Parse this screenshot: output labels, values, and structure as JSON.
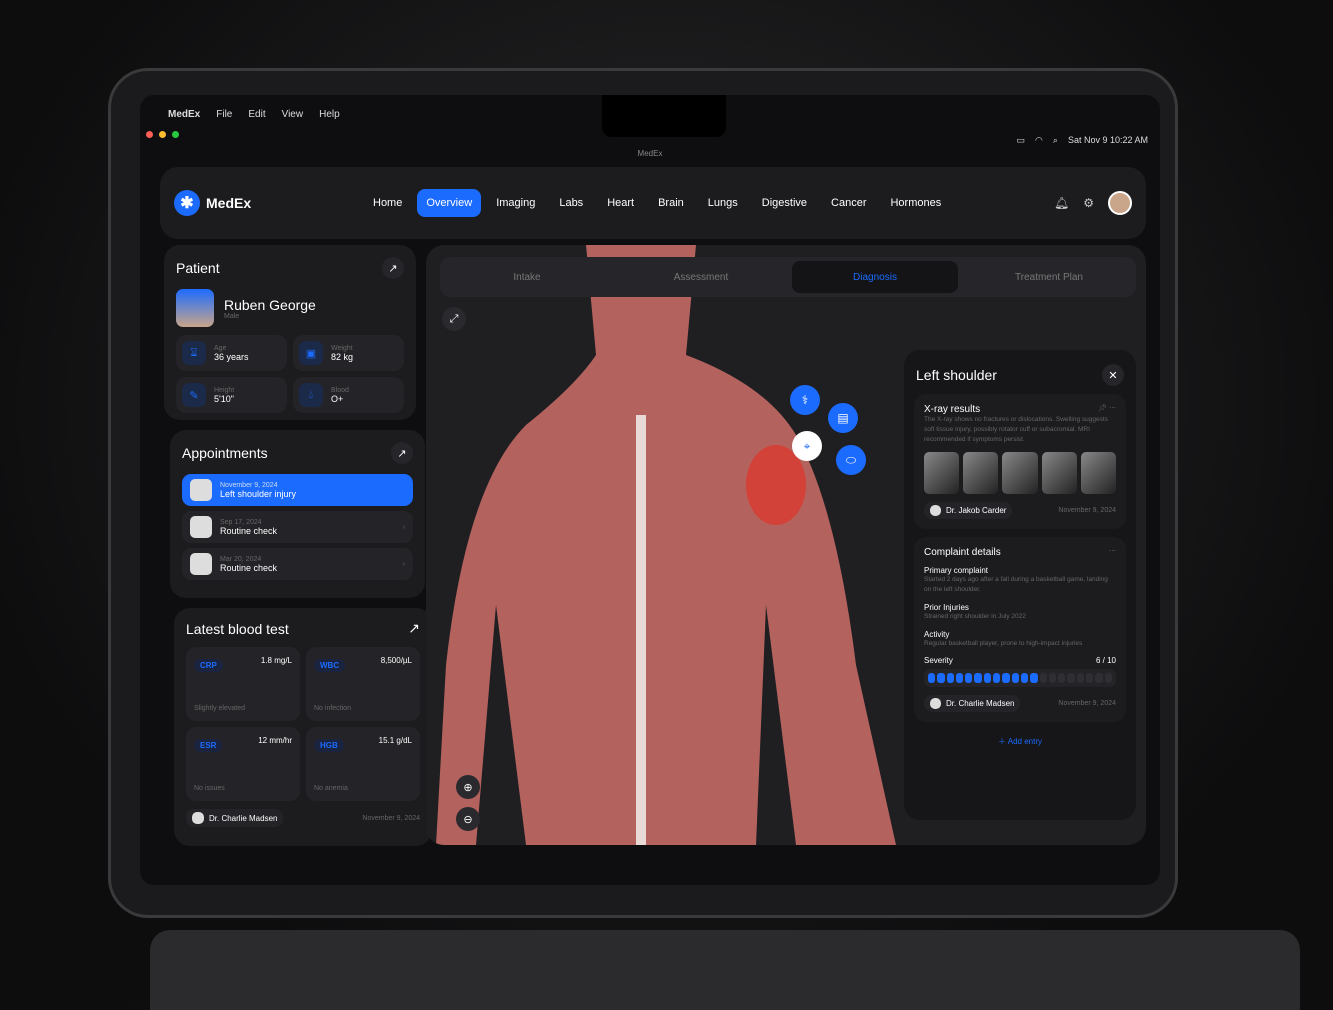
{
  "menubar": {
    "app": "MedEx",
    "items": [
      "File",
      "Edit",
      "View",
      "Help"
    ],
    "datetime": "Sat Nov 9  10:22 AM"
  },
  "window": {
    "title": "MedEx"
  },
  "nav": {
    "brand": "MedEx",
    "tabs": [
      "Home",
      "Overview",
      "Imaging",
      "Labs",
      "Heart",
      "Brain",
      "Lungs",
      "Digestive",
      "Cancer",
      "Hormones"
    ],
    "active": "Overview"
  },
  "patient": {
    "title": "Patient",
    "name": "Ruben George",
    "sex": "Male",
    "stats": [
      {
        "label": "Age",
        "value": "36 years",
        "icon": "hourglass-icon"
      },
      {
        "label": "Weight",
        "value": "82 kg",
        "icon": "scale-icon"
      },
      {
        "label": "Height",
        "value": "5'10\"",
        "icon": "ruler-icon"
      },
      {
        "label": "Blood",
        "value": "O+",
        "icon": "drop-icon"
      }
    ]
  },
  "appointments": {
    "title": "Appointments",
    "items": [
      {
        "date": "November 9, 2024",
        "title": "Left shoulder injury"
      },
      {
        "date": "Sep 17, 2024",
        "title": "Routine check"
      },
      {
        "date": "Mar 20, 2024",
        "title": "Routine check"
      }
    ]
  },
  "blood": {
    "title": "Latest blood test",
    "tests": [
      {
        "tag": "CRP",
        "value": "1.8 mg/L",
        "note": "Slightly elevated"
      },
      {
        "tag": "WBC",
        "value": "8,500/µL",
        "note": "No infection"
      },
      {
        "tag": "ESR",
        "value": "12 mm/hr",
        "note": "No issues"
      },
      {
        "tag": "HGB",
        "value": "15.1 g/dL",
        "note": "No anemia"
      }
    ],
    "doctor": "Dr. Charlie Madsen",
    "date": "November 9, 2024"
  },
  "steps": {
    "items": [
      "Intake",
      "Assessment",
      "Diagnosis",
      "Treatment Plan"
    ],
    "active": "Diagnosis"
  },
  "detail": {
    "title": "Left shoulder",
    "xray": {
      "title": "X-ray results",
      "text": "The X-ray shows no fractures or dislocations. Swelling suggests soft tissue injury, possibly rotator cuff or subacromial. MRI recommended if symptoms persist.",
      "doctor": "Dr. Jakob Carder",
      "date": "November 9, 2024"
    },
    "complaint": {
      "title": "Complaint details",
      "primary_label": "Primary complaint",
      "primary": "Started 2 days ago after a fall during a basketball game, landing on the left shoulder.",
      "prior_label": "Prior Injuries",
      "prior": "Strained right shoulder in July 2022",
      "activity_label": "Activity",
      "activity": "Regular basketball player, prone to high-impact injuries",
      "severity_label": "Severity",
      "severity": "6 / 10",
      "severity_value": 6,
      "severity_max": 10,
      "doctor": "Dr. Charlie Madsen",
      "date": "November 9, 2024"
    },
    "add": "Add entry"
  },
  "colors": {
    "accent": "#1c6bff",
    "background": "#0e0e10",
    "card": "#1c1c1f"
  }
}
